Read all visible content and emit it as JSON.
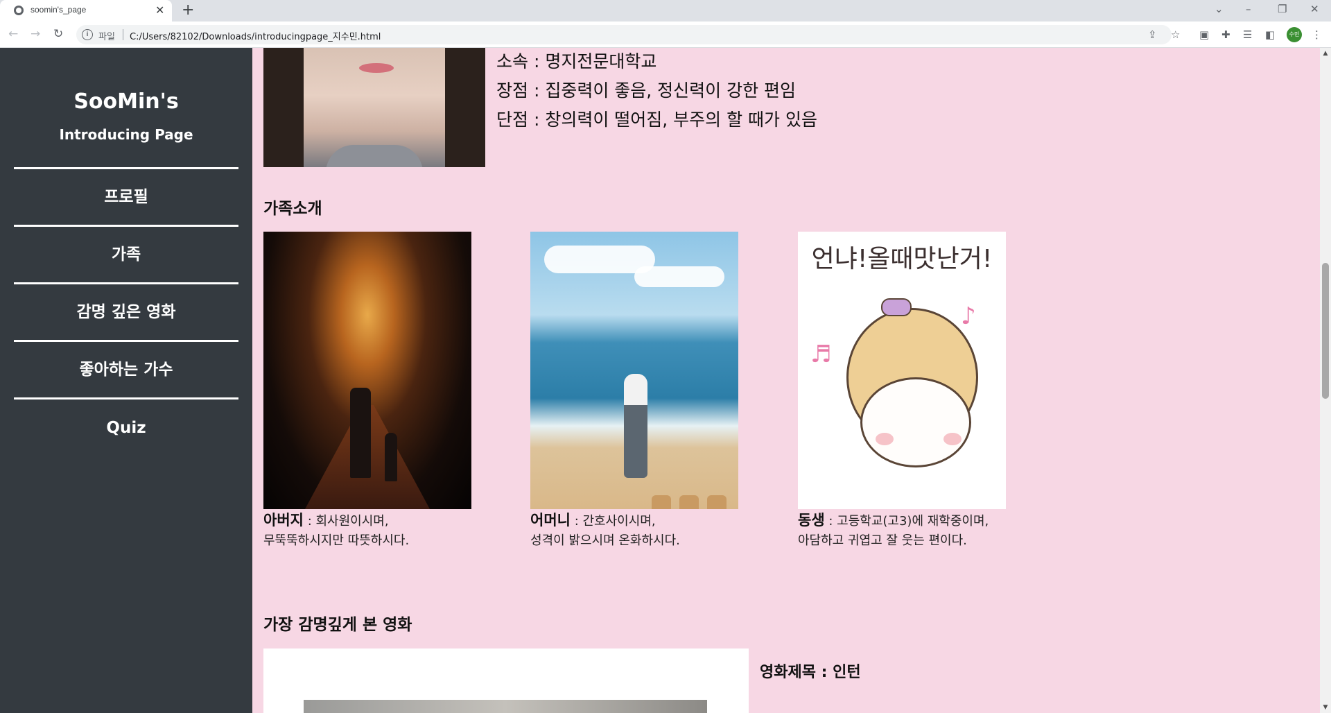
{
  "browser": {
    "tab_title": "soomin's_page",
    "new_tab_symbol": "+",
    "address_scheme": "파일",
    "address_url": "C:/Users/82102/Downloads/introducingpage_지수민.html",
    "profile_label": "수민"
  },
  "sidebar": {
    "title": "SooMin's",
    "subtitle": "Introducing Page",
    "items": [
      {
        "label": "프로필"
      },
      {
        "label": "가족"
      },
      {
        "label": "감명 깊은 영화"
      },
      {
        "label": "좋아하는 가수"
      },
      {
        "label": "Quiz"
      }
    ]
  },
  "profile": {
    "lines": [
      "소속 : 명지전문대학교",
      "장점 : 집중력이 좋음, 정신력이 강한 편임",
      "단점 : 창의력이 떨어짐, 부주의 할 때가 있음"
    ]
  },
  "family": {
    "heading": "가족소개",
    "members": [
      {
        "name": "아버지",
        "desc1": " : 회사원이시며,",
        "desc2": "무뚝뚝하시지만 따뜻하시다."
      },
      {
        "name": "어머니",
        "desc1": " : 간호사이시며,",
        "desc2": "성격이 밝으시며 온화하시다."
      },
      {
        "name": "동생",
        "desc1": " : 고등학교(고3)에 재학중이며,",
        "desc2": "아담하고 귀엽고 잘 웃는 편이다."
      }
    ],
    "sister_image_text": "언냐!올때맛난거!"
  },
  "movie": {
    "heading": "가장 감명깊게 본 영화",
    "title_line": "영화제목 : 인턴"
  },
  "colors": {
    "page_bg": "#f7d7e4",
    "sidebar_bg": "#343a40",
    "sidebar_text": "#ffffff"
  }
}
